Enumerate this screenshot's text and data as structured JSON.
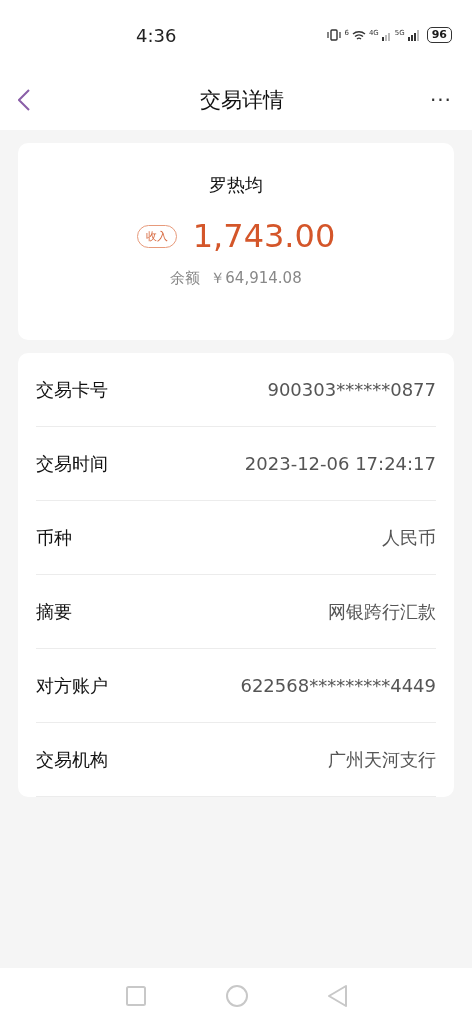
{
  "status_bar": {
    "time": "4:36",
    "wifi_label": "6",
    "network_1": "4G",
    "network_2": "5G",
    "battery": "96"
  },
  "header": {
    "title": "交易详情",
    "menu": "···"
  },
  "summary": {
    "name": "罗热均",
    "tag": "收入",
    "amount": "1,743.00",
    "balance_label": "余额",
    "balance": "￥64,914.08"
  },
  "details": [
    {
      "label": "交易卡号",
      "value": "900303******0877"
    },
    {
      "label": "交易时间",
      "value": "2023-12-06 17:24:17"
    },
    {
      "label": "币种",
      "value": "人民币"
    },
    {
      "label": "摘要",
      "value": "网银跨行汇款"
    },
    {
      "label": "对方账户",
      "value": "622568*********4449"
    },
    {
      "label": "交易机构",
      "value": "广州天河支行"
    }
  ]
}
